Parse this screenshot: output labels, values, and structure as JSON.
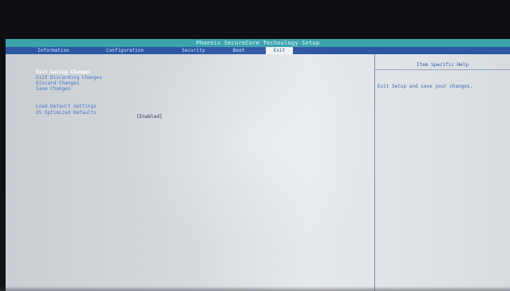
{
  "title": "Phoenix SecureCore Technology Setup",
  "tabs": [
    {
      "label": "Information"
    },
    {
      "label": "Configuration"
    },
    {
      "label": "Security"
    },
    {
      "label": "Boot"
    },
    {
      "label": "Exit",
      "active": true
    }
  ],
  "menu": {
    "items": [
      {
        "label": "Exit Saving Changes",
        "selected": true
      },
      {
        "label": "Exit Discarding Changes"
      },
      {
        "label": "Discard Changes"
      },
      {
        "label": "Save Changes"
      },
      {
        "label": "Load Default Settings"
      },
      {
        "label": "OS Optimized Defaults"
      }
    ],
    "os_optimized_value": "[Enabled]"
  },
  "help": {
    "title": "Item Specific Help",
    "text": "Exit Setup and save your changes."
  },
  "colors": {
    "title_bar": "#3aa3ad",
    "tab_bar": "#2d56a5",
    "menu_text": "#4377c6",
    "help_text": "#3e68b1",
    "screen_bg": "#d7dbdf"
  }
}
